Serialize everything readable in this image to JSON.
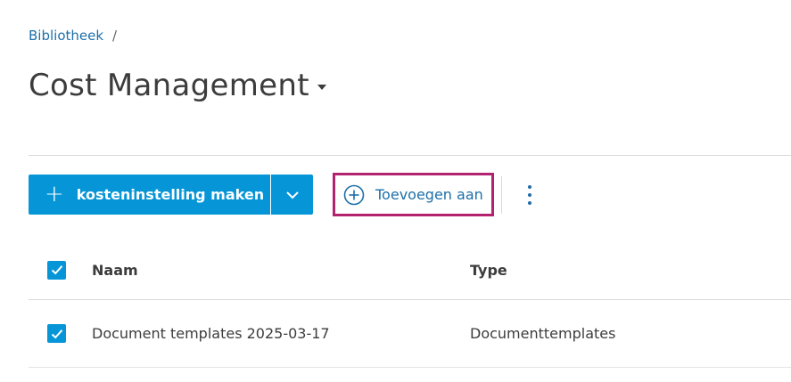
{
  "breadcrumb": {
    "root": "Bibliotheek",
    "separator": "/"
  },
  "page": {
    "title": "Cost Management"
  },
  "toolbar": {
    "create_label": "kosteninstelling maken",
    "add_label": "Toevoegen aan"
  },
  "table": {
    "headers": {
      "name": "Naam",
      "type": "Type"
    },
    "rows": [
      {
        "name": "Document templates 2025-03-17",
        "type": "Documenttemplates",
        "checked": true
      }
    ]
  },
  "colors": {
    "accent": "#0696d7",
    "link": "#1e6fa8",
    "highlight": "#b3226e"
  }
}
